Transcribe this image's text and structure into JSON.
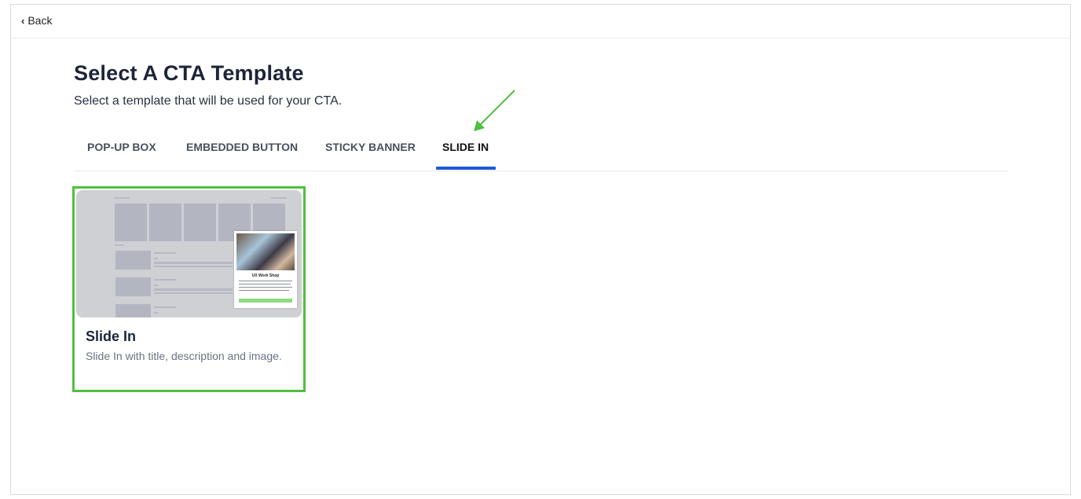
{
  "topbar": {
    "back_label": "Back"
  },
  "header": {
    "title": "Select A CTA Template",
    "subtitle": "Select a template that will be used for your CTA."
  },
  "tabs": [
    {
      "label": "POP-UP BOX",
      "active": false
    },
    {
      "label": "EMBEDDED BUTTON",
      "active": false
    },
    {
      "label": "STICKY BANNER",
      "active": false
    },
    {
      "label": "SLIDE IN",
      "active": true
    }
  ],
  "templates": [
    {
      "title": "Slide In",
      "description": "Slide In with title, description and image.",
      "preview_popup_title": "UX Work Shop",
      "selected": true
    }
  ],
  "colors": {
    "accent": "#1c5ad6",
    "selection_border": "#4fbf3f",
    "annotation_arrow": "#4fbf3f"
  }
}
